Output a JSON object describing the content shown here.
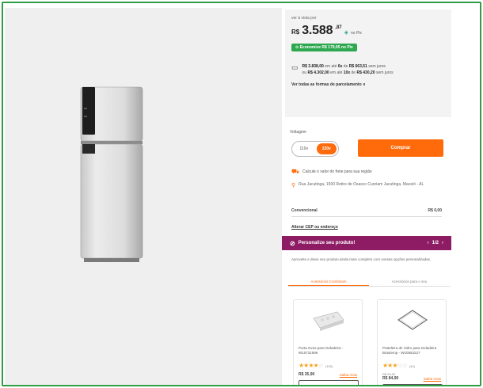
{
  "price": {
    "small_label": "ver à vista por",
    "currency": "R$",
    "value": "3.588",
    "cents": ",87",
    "pix_label": "no Pix",
    "savings_badge": "Economize R$ 179,05 no Pix",
    "installment_line1_prefix": "R$ 3.838,00",
    "installment_line1_mid": "em até",
    "installment_line1_qty": "6x",
    "installment_line1_of": "de",
    "installment_line1_amount": "R$ 663,51",
    "installment_line1_suffix": "sem juros",
    "installment_line2_prefix": "ou",
    "installment_line2_total": "R$ 4.302,00",
    "installment_line2_mid": "em até",
    "installment_line2_qty": "10x",
    "installment_line2_of": "de",
    "installment_line2_amount": "R$ 430,20",
    "installment_line2_suffix": "sem juros",
    "see_all_link": "Ver todas as formas de parcelamento ∨"
  },
  "voltage": {
    "label": "Voltagem",
    "options": [
      "110v",
      "220v"
    ],
    "selected": "220v"
  },
  "buy_button": "Comprar",
  "shipping": {
    "calc_text": "Calcule o valor do frete para sua região",
    "pickup_text": "Rua Jacutinga, 1500 Retire de Osasco Cuoriam Jacutinga, Maceió - AL",
    "cep_label": "Convencional",
    "cep_value": "R$ 0,00",
    "change_cep": "Alterar CEP ou endereço"
  },
  "customize": {
    "title": "Personalize seu produto!",
    "counter": "1/2",
    "description": "Aproveite e deixe seu produto ainda mais completo com nossas opções personalizadas."
  },
  "tabs": [
    "Acessórios Combinam",
    "Acessórios para o seu"
  ],
  "active_tab": 0,
  "products": [
    {
      "name": "Porta Ovos para Geladeira - W10731596",
      "rating": 4,
      "reviews": "(106)",
      "price": "R$ 35,90",
      "old_price": "",
      "link": "Saiba mais",
      "image_icon": "egg-tray-icon"
    },
    {
      "name": "Prateleira de Vidro para Geladeira Brastemp - W10553227",
      "rating": 3,
      "reviews": "(43)",
      "price": "R$ 84,90",
      "old_price": "R$ 99,90",
      "link": "Saiba mais",
      "image_icon": "glass-shelf-icon"
    }
  ],
  "colors": {
    "accent": "#ff6a0a",
    "savings_green": "#2ea84f",
    "customize_bg": "#8d1c64",
    "frame_border": "#2e9e45"
  }
}
